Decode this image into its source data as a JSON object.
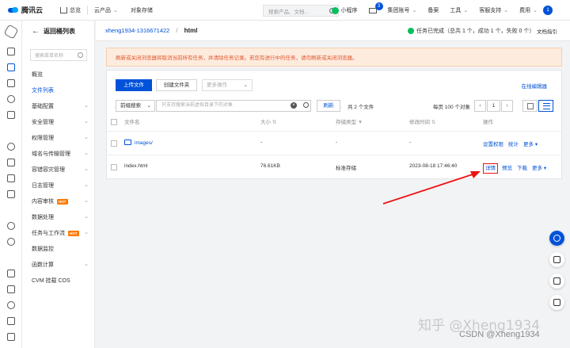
{
  "topbar": {
    "brand": "腾讯云",
    "overview": "总览",
    "products": "云产品",
    "service": "对象存储",
    "search_placeholder": "搜索产品、文档...",
    "mini_program": "小程序",
    "mail_badge": "3",
    "group_account": "集团账号",
    "filing": "备案",
    "tools": "工具",
    "support": "客服支持",
    "billing": "费用",
    "avatar_initial": "1"
  },
  "sidebar": {
    "back_label": "返回桶列表",
    "search_placeholder": "搜索菜单名称",
    "items": [
      {
        "label": "概览",
        "chevron": false,
        "hot": false
      },
      {
        "label": "文件列表",
        "chevron": false,
        "hot": false,
        "active": true
      },
      {
        "label": "基础配置",
        "chevron": true,
        "hot": false
      },
      {
        "label": "安全管理",
        "chevron": true,
        "hot": false
      },
      {
        "label": "权限管理",
        "chevron": true,
        "hot": false
      },
      {
        "label": "域名与传输管理",
        "chevron": true,
        "hot": false
      },
      {
        "label": "容错容灾管理",
        "chevron": true,
        "hot": false
      },
      {
        "label": "日志管理",
        "chevron": true,
        "hot": false
      },
      {
        "label": "内容审核",
        "chevron": true,
        "hot": true
      },
      {
        "label": "数据处理",
        "chevron": true,
        "hot": false
      },
      {
        "label": "任务与工作流",
        "chevron": true,
        "hot": true
      },
      {
        "label": "数据监控",
        "chevron": false,
        "hot": false
      },
      {
        "label": "函数计算",
        "chevron": true,
        "hot": false
      },
      {
        "label": "CVM 挂载 COS",
        "chevron": false,
        "hot": false
      }
    ],
    "hot_label": "HOT"
  },
  "breadcrumb": {
    "bucket": "xheng1934-1316671422",
    "separator": "/",
    "current": "html",
    "task_status": "任务已完成（总共 1 个，成功 1 个，失败 0 个）",
    "doc_link": "文档指引"
  },
  "notice": "刷新或关闭浏览器将取消当前所有任务，并清除任务记录。若您有进行中的任务，请勿刷新或关闭浏览器。",
  "toolbar": {
    "upload": "上传文件",
    "create_folder": "创建文件夹",
    "more_ops": "更多操作",
    "online_editor": "在线编辑器"
  },
  "filter": {
    "mode": "前缀搜索",
    "placeholder": "只支持搜索当前虚拟目录下的对象",
    "refresh": "刷新",
    "total": "共 2 个文件",
    "per_page": "每页 100 个对象",
    "page": "1"
  },
  "table": {
    "headers": {
      "name": "文件名",
      "size": "大小",
      "type": "存储类型",
      "time": "修改时间",
      "ops": "操作"
    },
    "rows": [
      {
        "name": "images/",
        "size": "-",
        "type": "-",
        "time": "-",
        "ops": [
          "设置权限",
          "统计",
          "更多"
        ]
      },
      {
        "name": "index.html",
        "size": "76.61KB",
        "type": "标准存储",
        "time": "2023-08-18 17:46:40",
        "ops": [
          "详情",
          "预览",
          "下载",
          "更多"
        ]
      }
    ]
  },
  "watermark": {
    "zhihu": "知乎 @Xheng1934",
    "csdn": "CSDN @Xheng1934"
  },
  "colors": {
    "primary": "#0052d9",
    "notice_text": "#e2542c",
    "notice_bg": "#fdecde",
    "annotation": "#e11111"
  }
}
